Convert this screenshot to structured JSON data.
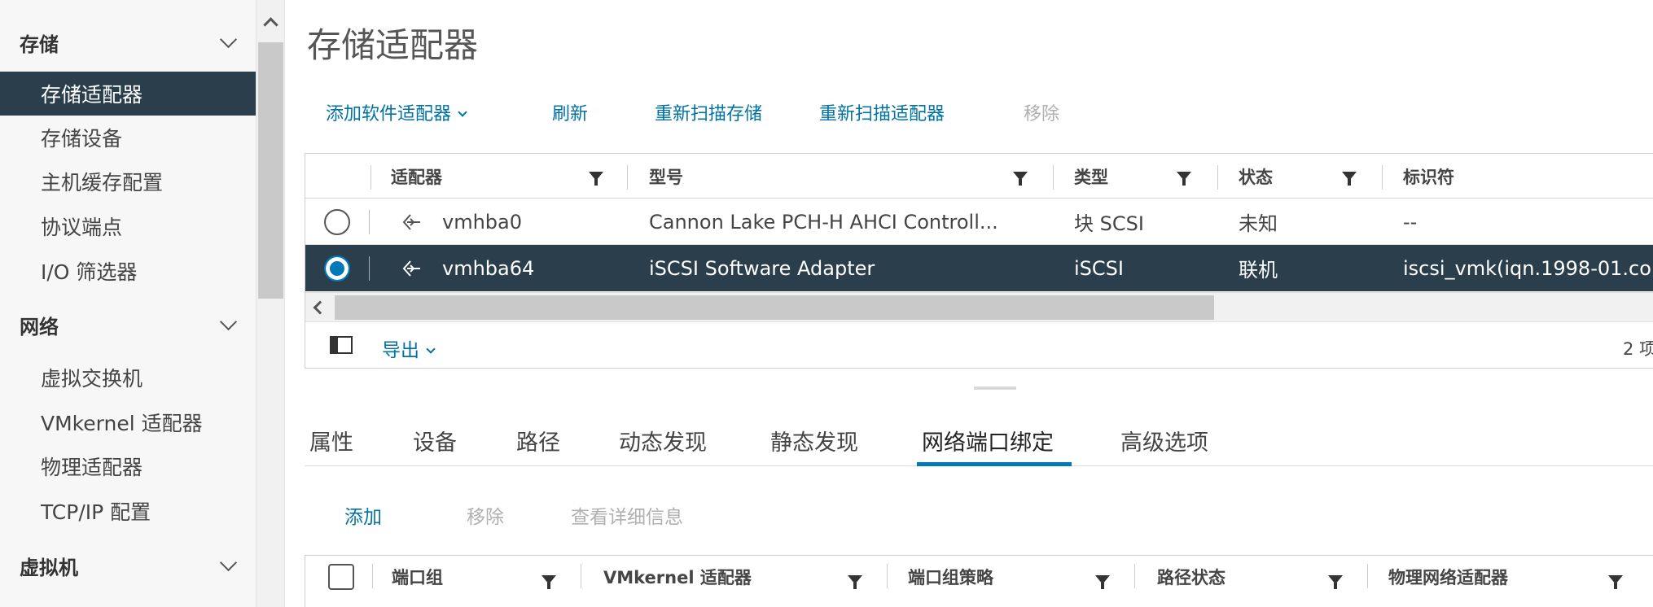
{
  "sidebar": {
    "sections": [
      {
        "title": "存储",
        "items": [
          "存储适配器",
          "存储设备",
          "主机缓存配置",
          "协议端点",
          "I/O 筛选器"
        ]
      },
      {
        "title": "网络",
        "items": [
          "虚拟交换机",
          "VMkernel 适配器",
          "物理适配器",
          "TCP/IP 配置"
        ]
      },
      {
        "title": "虚拟机",
        "items": []
      }
    ],
    "selected_item": "存储适配器"
  },
  "page_title": "存储适配器",
  "toolbar": {
    "add_software_adapter": "添加软件适配器",
    "refresh": "刷新",
    "rescan_storage": "重新扫描存储",
    "rescan_adapter": "重新扫描适配器",
    "remove": "移除"
  },
  "adapters_grid": {
    "columns": [
      "适配器",
      "型号",
      "类型",
      "状态",
      "标识符"
    ],
    "rows": [
      {
        "adapter": "vmhba0",
        "model": "Cannon Lake PCH-H AHCI Controll...",
        "type": "块 SCSI",
        "status": "未知",
        "identifier": "--",
        "selected": false
      },
      {
        "adapter": "vmhba64",
        "model": "iSCSI Software Adapter",
        "type": "iSCSI",
        "status": "联机",
        "identifier": "iscsi_vmk(iqn.1998-01.co",
        "selected": true
      }
    ],
    "export_label": "导出",
    "item_count": "2 项"
  },
  "detail_tabs": {
    "tabs": [
      "属性",
      "设备",
      "路径",
      "动态发现",
      "静态发现",
      "网络端口绑定",
      "高级选项"
    ],
    "active": "网络端口绑定"
  },
  "binding_toolbar": {
    "add": "添加",
    "remove": "移除",
    "view_details": "查看详细信息"
  },
  "binding_grid": {
    "columns": [
      "端口组",
      "VMkernel 适配器",
      "端口组策略",
      "路径状态",
      "物理网络适配器"
    ]
  },
  "colors": {
    "selection_bg": "#2b3e4c",
    "link": "#0072a3",
    "accent": "#0079b8",
    "disabled": "#b0b0b0"
  },
  "icons": [
    "chevron-down-icon",
    "chevron-up-icon",
    "filter-icon",
    "adapter-icon",
    "radio-icon",
    "column-toggle-icon",
    "chevron-left-icon",
    "checkbox-icon"
  ]
}
